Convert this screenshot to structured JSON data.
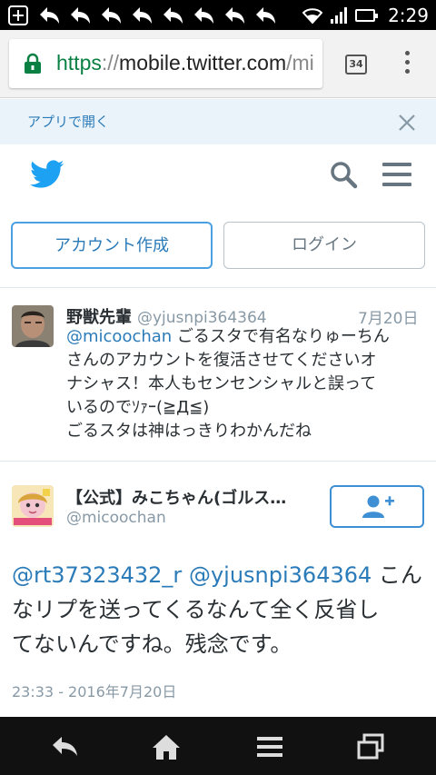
{
  "status_bar": {
    "time": "2:29",
    "icons": [
      "add-icon",
      "back-arrow-icon",
      "wifi-icon",
      "signal-icon",
      "battery-icon"
    ]
  },
  "browser": {
    "url_scheme": "https",
    "url_separator": "://",
    "url_host": "mobile.twitter.com",
    "url_path": "/mi",
    "tab_count": "34"
  },
  "app_banner": {
    "open_in_app": "アプリで開く"
  },
  "auth": {
    "signup_label": "アカウント作成",
    "login_label": "ログイン"
  },
  "tweets": [
    {
      "name": "野獣先輩",
      "handle": "@yjusnpi364364",
      "date": "7月20日",
      "reply_to": "@micoochan",
      "text_line1_rest": " ごるスタで有名なりゅーちん",
      "text_lines": [
        "さんのアカウントを復活させてくださいオ",
        "ナシャス！本人もセンセンシャルと誤って",
        "いるのでｿｧｰ(≧Д≦)",
        "ごるスタは神はっきりわかんだね"
      ]
    }
  ],
  "main_tweet": {
    "name": "【公式】みこちゃん(ゴルス…",
    "handle": "@micoochan",
    "mention1": "@rt37323432_r",
    "mention2": "@yjusnpi364364",
    "text_after_mentions": " こん",
    "text_lines": [
      "なリプを送ってくるなんて全く反省し",
      "てないんですね。残念です。"
    ],
    "timestamp": "23:33 - 2016年7月20日"
  },
  "colors": {
    "twitter_blue": "#1da1f2",
    "link_blue": "#2b7bb9",
    "secure_green": "#0b8043",
    "muted_gray": "#8899a6"
  }
}
